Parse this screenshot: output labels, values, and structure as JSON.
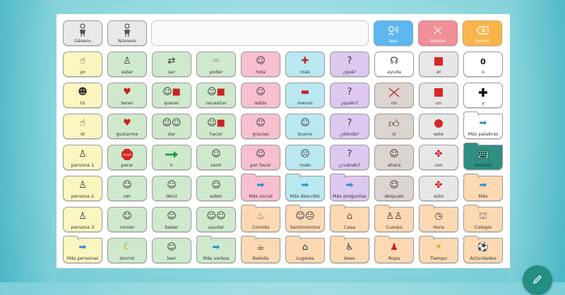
{
  "top_row": {
    "genero": "Género",
    "numero": "Número",
    "message_text": "",
    "leer": "leer",
    "limpiar": "limpiar",
    "borrar": "borrar"
  },
  "cells": {
    "c_1_0": "yo",
    "c_1_1": "estar",
    "c_1_2": "ser",
    "c_1_3": "poder",
    "c_1_4": "hola",
    "c_1_5": "más",
    "c_1_6": "¿qué?",
    "c_1_7": "ayuda",
    "c_1_8": "el",
    "c_1_9": "o",
    "c_2_0": "tú",
    "c_2_1": "tener",
    "c_2_2": "querer",
    "c_2_3": "necesitar",
    "c_2_4": "adiós",
    "c_2_5": "menos",
    "c_2_6": "¿quién?",
    "c_2_7": "no",
    "c_2_8": "un",
    "c_2_9": "y",
    "c_3_0": "él",
    "c_3_1": "gustarme",
    "c_3_2": "dar",
    "c_3_3": "hacer",
    "c_3_4": "gracias",
    "c_3_5": "bueno",
    "c_3_6": "¿dónde?",
    "c_3_7": "sí",
    "c_3_8": "este",
    "c_3_9": "Más palabras",
    "c_4_0": "persona 1",
    "c_4_1": "parar",
    "c_4_2": "ir",
    "c_4_3": "venir",
    "c_4_4": "por favor",
    "c_4_5": "malo",
    "c_4_6": "¿cuándo?",
    "c_4_7": "ahora",
    "c_4_8": "con",
    "c_4_9": "teclado",
    "c_5_0": "persona 2",
    "c_5_1": "ver",
    "c_5_2": "decir",
    "c_5_3": "saber",
    "c_5_4": "Más social",
    "c_5_5": "Más describir",
    "c_5_6": "Más preguntas",
    "c_5_7": "después",
    "c_5_8": "esto",
    "c_5_9": "Más",
    "c_6_0": "persona 3",
    "c_6_1": "comer",
    "c_6_2": "beber",
    "c_6_3": "ayudar",
    "c_6_4": "Comida",
    "c_6_5": "Sentimientos",
    "c_6_6": "Casa",
    "c_6_7": "Cuerpo",
    "c_6_8": "Hora",
    "c_6_9": "Colegio",
    "c_7_0": "Más personas",
    "c_7_1": "dormir",
    "c_7_2": "leer",
    "c_7_3": "Más verbos",
    "c_7_4": "Bebida",
    "c_7_5": "Lugares",
    "c_7_6": "Aseo",
    "c_7_7": "Ropa",
    "c_7_8": "Tiempo",
    "c_7_9": "Actividades"
  },
  "symbols": {
    "zero": "0",
    "stop": "STOP"
  },
  "colors": {
    "personas": "#fbf5bf",
    "verbos": "#cfe9cd",
    "social": "#f8c0cf",
    "describir": "#b9e8f1",
    "preguntas": "#ddc8f0",
    "adverbios": "#dcd4cf",
    "categorias": "#fdd9b3",
    "teclado": "#2e8f82",
    "leer_button": "#5fb7ef",
    "limpiar_button": "#f08f96",
    "borrar_button": "#f7b54b"
  }
}
